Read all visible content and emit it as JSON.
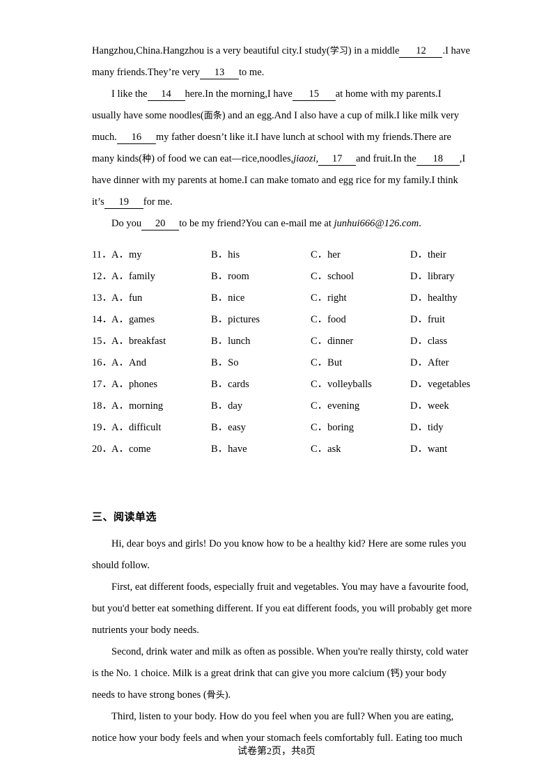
{
  "document": {
    "type": "english-exam-paper",
    "footer": {
      "prefix": "试卷第",
      "current_page": "2",
      "middle": "页，共",
      "total_pages": "8",
      "suffix": "页"
    }
  },
  "cloze": {
    "lines": [
      {
        "id": "line1",
        "segments": [
          {
            "t": "text",
            "v": "Hangzhou,China.Hangzhou is a very beautiful city.I study("
          },
          {
            "t": "cn",
            "v": "学习"
          },
          {
            "t": "text",
            "v": ") in a middle"
          },
          {
            "t": "blank",
            "v": "12"
          },
          {
            "t": "text",
            "v": ".I have"
          }
        ]
      },
      {
        "id": "line2",
        "segments": [
          {
            "t": "text",
            "v": "many friends.They’re very"
          },
          {
            "t": "blank",
            "v": "13"
          },
          {
            "t": "text",
            "v": "to me."
          }
        ]
      },
      {
        "id": "line3",
        "segments": [
          {
            "t": "indent",
            "v": ""
          },
          {
            "t": "text",
            "v": "I like the"
          },
          {
            "t": "blank",
            "v": "14"
          },
          {
            "t": "text",
            "v": "here.In the morning,I have"
          },
          {
            "t": "blank",
            "v": "15"
          },
          {
            "t": "text",
            "v": "at home with my parents.I"
          }
        ]
      },
      {
        "id": "line4",
        "segments": [
          {
            "t": "text",
            "v": "usually have some noodles("
          },
          {
            "t": "cn",
            "v": "面条"
          },
          {
            "t": "text",
            "v": ") and an egg.And I also have a cup of milk.I like milk very"
          }
        ]
      },
      {
        "id": "line5",
        "segments": [
          {
            "t": "text",
            "v": "much."
          },
          {
            "t": "blank",
            "v": "16"
          },
          {
            "t": "text",
            "v": "my father doesn’t like it.I have lunch at school with my friends.There are"
          }
        ]
      },
      {
        "id": "line6",
        "segments": [
          {
            "t": "text",
            "v": "many kinds("
          },
          {
            "t": "cn",
            "v": "种"
          },
          {
            "t": "text",
            "v": ") of food we can eat—rice,noodles,"
          },
          {
            "t": "ital",
            "v": "jiaozi,"
          },
          {
            "t": "blank",
            "v": "17"
          },
          {
            "t": "text",
            "v": "and fruit.In the"
          },
          {
            "t": "blank",
            "v": "18"
          },
          {
            "t": "text",
            "v": ",I"
          }
        ]
      },
      {
        "id": "line7",
        "segments": [
          {
            "t": "text",
            "v": "have dinner with my parents at home.I can make tomato and egg rice for my family.I think"
          }
        ]
      },
      {
        "id": "line8",
        "segments": [
          {
            "t": "text",
            "v": "it’s"
          },
          {
            "t": "blank",
            "v": "19"
          },
          {
            "t": "text",
            "v": "for me."
          }
        ]
      },
      {
        "id": "line9",
        "segments": [
          {
            "t": "indent",
            "v": ""
          },
          {
            "t": "text",
            "v": "Do you"
          },
          {
            "t": "blank",
            "v": "20"
          },
          {
            "t": "text",
            "v": "to be my friend?You can e‑mail me at "
          },
          {
            "t": "ital",
            "v": "junhui666@126.com"
          },
          {
            "t": "text",
            "v": "."
          }
        ]
      }
    ]
  },
  "questions": [
    {
      "number": "11．",
      "options": [
        "A．my",
        "B．his",
        "C．her",
        "D．their"
      ]
    },
    {
      "number": "12．",
      "options": [
        "A．family",
        "B．room",
        "C．school",
        "D．library"
      ]
    },
    {
      "number": "13．",
      "options": [
        "A．fun",
        "B．nice",
        "C．right",
        "D．healthy"
      ]
    },
    {
      "number": "14．",
      "options": [
        "A．games",
        "B．pictures",
        "C．food",
        "D．fruit"
      ]
    },
    {
      "number": "15．",
      "options": [
        "A．breakfast",
        "B．lunch",
        "C．dinner",
        "D．class"
      ]
    },
    {
      "number": "16．",
      "options": [
        "A．And",
        "B．So",
        "C．But",
        "D．After"
      ]
    },
    {
      "number": "17．",
      "options": [
        "A．phones",
        "B．cards",
        "C．volleyballs",
        "D．vegetables"
      ]
    },
    {
      "number": "18．",
      "options": [
        "A．morning",
        "B．day",
        "C．evening",
        "D．week"
      ]
    },
    {
      "number": "19．",
      "options": [
        "A．difficult",
        "B．easy",
        "C．boring",
        "D．tidy"
      ]
    },
    {
      "number": "20．",
      "options": [
        "A．come",
        "B．have",
        "C．ask",
        "D．want"
      ]
    }
  ],
  "reading_section": {
    "heading": "三、阅读单选",
    "lines": [
      {
        "id": "r1",
        "segments": [
          {
            "t": "indent",
            "v": ""
          },
          {
            "t": "text",
            "v": "Hi, dear boys and girls! Do you know how to be a healthy kid? Here are some rules you"
          }
        ]
      },
      {
        "id": "r2",
        "segments": [
          {
            "t": "text",
            "v": "should follow."
          }
        ]
      },
      {
        "id": "r3",
        "segments": [
          {
            "t": "indent",
            "v": ""
          },
          {
            "t": "text",
            "v": "First, eat different foods, especially fruit and vegetables. You may have a favourite food,"
          }
        ]
      },
      {
        "id": "r4",
        "segments": [
          {
            "t": "text",
            "v": "but you'd better eat something different. If you eat different foods, you will probably get more"
          }
        ]
      },
      {
        "id": "r5",
        "segments": [
          {
            "t": "text",
            "v": "nutrients your body needs."
          }
        ]
      },
      {
        "id": "r6",
        "segments": [
          {
            "t": "indent",
            "v": ""
          },
          {
            "t": "text",
            "v": "Second, drink water and milk as often as possible. When you're really thirsty, cold water"
          }
        ]
      },
      {
        "id": "r7",
        "segments": [
          {
            "t": "text",
            "v": "is the No. 1 choice. Milk is a great drink that can give you more calcium ("
          },
          {
            "t": "cn",
            "v": "钙"
          },
          {
            "t": "text",
            "v": ") your body"
          }
        ]
      },
      {
        "id": "r8",
        "segments": [
          {
            "t": "text",
            "v": "needs to have strong bones ("
          },
          {
            "t": "cn",
            "v": "骨头"
          },
          {
            "t": "text",
            "v": ")."
          }
        ]
      },
      {
        "id": "r9",
        "segments": [
          {
            "t": "indent",
            "v": ""
          },
          {
            "t": "text",
            "v": "Third, listen to your body. How do you feel when you are full? When you are eating,"
          }
        ]
      },
      {
        "id": "r10",
        "segments": [
          {
            "t": "text",
            "v": "notice how your body feels and when your stomach feels comfortably full. Eating too much"
          }
        ]
      }
    ]
  }
}
